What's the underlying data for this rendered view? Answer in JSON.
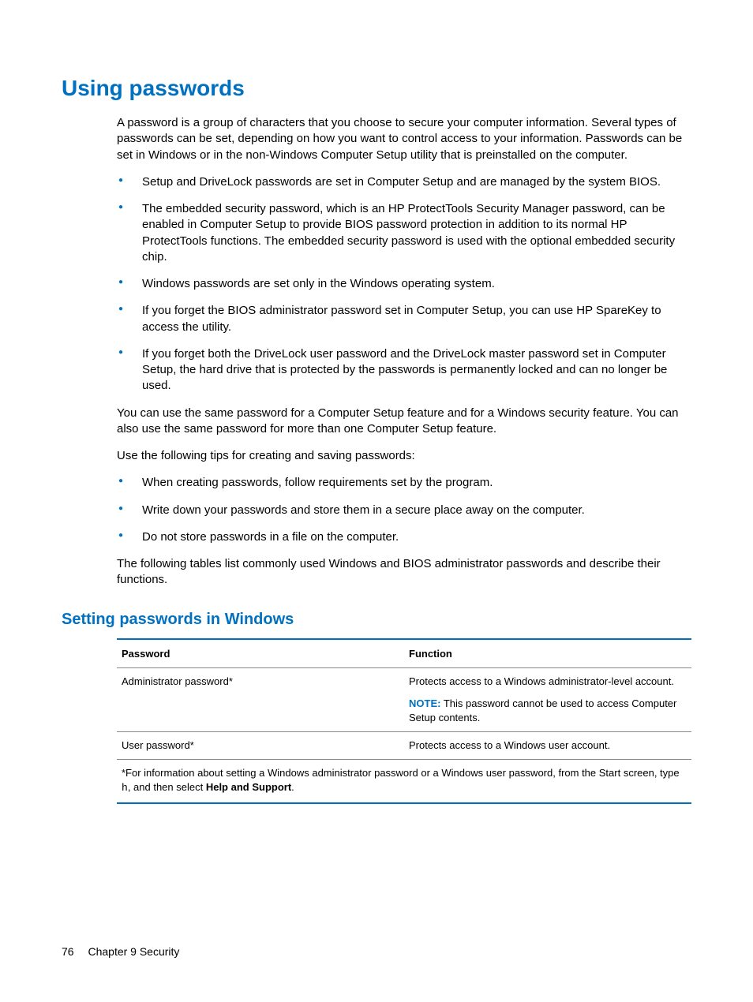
{
  "h1": "Using passwords",
  "intro": "A password is a group of characters that you choose to secure your computer information. Several types of passwords can be set, depending on how you want to control access to your information. Passwords can be set in Windows or in the non-Windows Computer Setup utility that is preinstalled on the computer.",
  "list1": {
    "i0": "Setup and DriveLock passwords are set in Computer Setup and are managed by the system BIOS.",
    "i1": "The embedded security password, which is an HP ProtectTools Security Manager password, can be enabled in Computer Setup to provide BIOS password protection in addition to its normal HP ProtectTools functions. The embedded security password is used with the optional embedded security chip.",
    "i2": "Windows passwords are set only in the Windows operating system.",
    "i3": "If you forget the BIOS administrator password set in Computer Setup, you can use HP SpareKey to access the utility.",
    "i4": "If you forget both the DriveLock user password and the DriveLock master password set in Computer Setup, the hard drive that is protected by the passwords is permanently locked and can no longer be used."
  },
  "para2": "You can use the same password for a Computer Setup feature and for a Windows security feature. You can also use the same password for more than one Computer Setup feature.",
  "para3": "Use the following tips for creating and saving passwords:",
  "list2": {
    "i0": "When creating passwords, follow requirements set by the program.",
    "i1": "Write down your passwords and store them in a secure place away on the computer.",
    "i2": "Do not store passwords in a file on the computer."
  },
  "para4": "The following tables list commonly used Windows and BIOS administrator passwords and describe their functions.",
  "h2": "Setting passwords in Windows",
  "table": {
    "th0": "Password",
    "th1": "Function",
    "r0c0": "Administrator password*",
    "r0c1a": "Protects access to a Windows administrator-level account.",
    "r0c1_note_label": "NOTE:",
    "r0c1_note_text": " This password cannot be used to access Computer Setup contents.",
    "r1c0": "User password*",
    "r1c1": "Protects access to a Windows user account.",
    "foot_pre": "*For information about setting a Windows administrator password or a Windows user password, from the Start screen, type ",
    "foot_code": "h",
    "foot_mid": ", and then select ",
    "foot_bold": "Help and Support",
    "foot_end": "."
  },
  "footer": {
    "page": "76",
    "chapter": "Chapter 9   Security"
  }
}
